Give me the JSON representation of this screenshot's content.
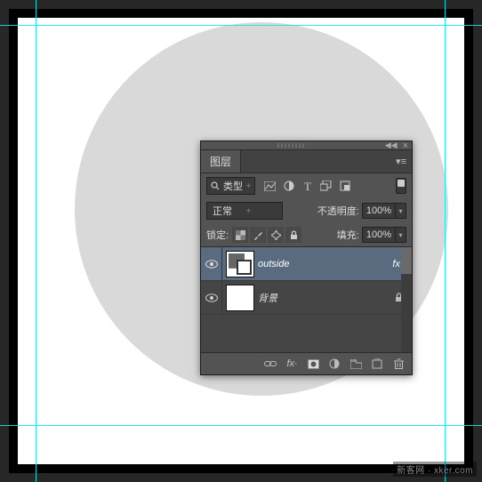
{
  "panel": {
    "title": "图层",
    "kind_label": "类型",
    "blend_mode": "正常",
    "opacity_label": "不透明度:",
    "opacity_value": "100%",
    "lock_label": "锁定:",
    "fill_label": "填充:",
    "fill_value": "100%"
  },
  "filters": {
    "image": "image-filter",
    "adjust": "adjust-filter",
    "type": "type-filter",
    "shape": "shape-filter",
    "smart": "smart-filter"
  },
  "layers": [
    {
      "name": "outside",
      "selected": true,
      "has_fx": true,
      "fx_label": "fx"
    },
    {
      "name": "背景",
      "selected": false,
      "locked": true
    }
  ],
  "watermark": "新客网 · xker.com"
}
